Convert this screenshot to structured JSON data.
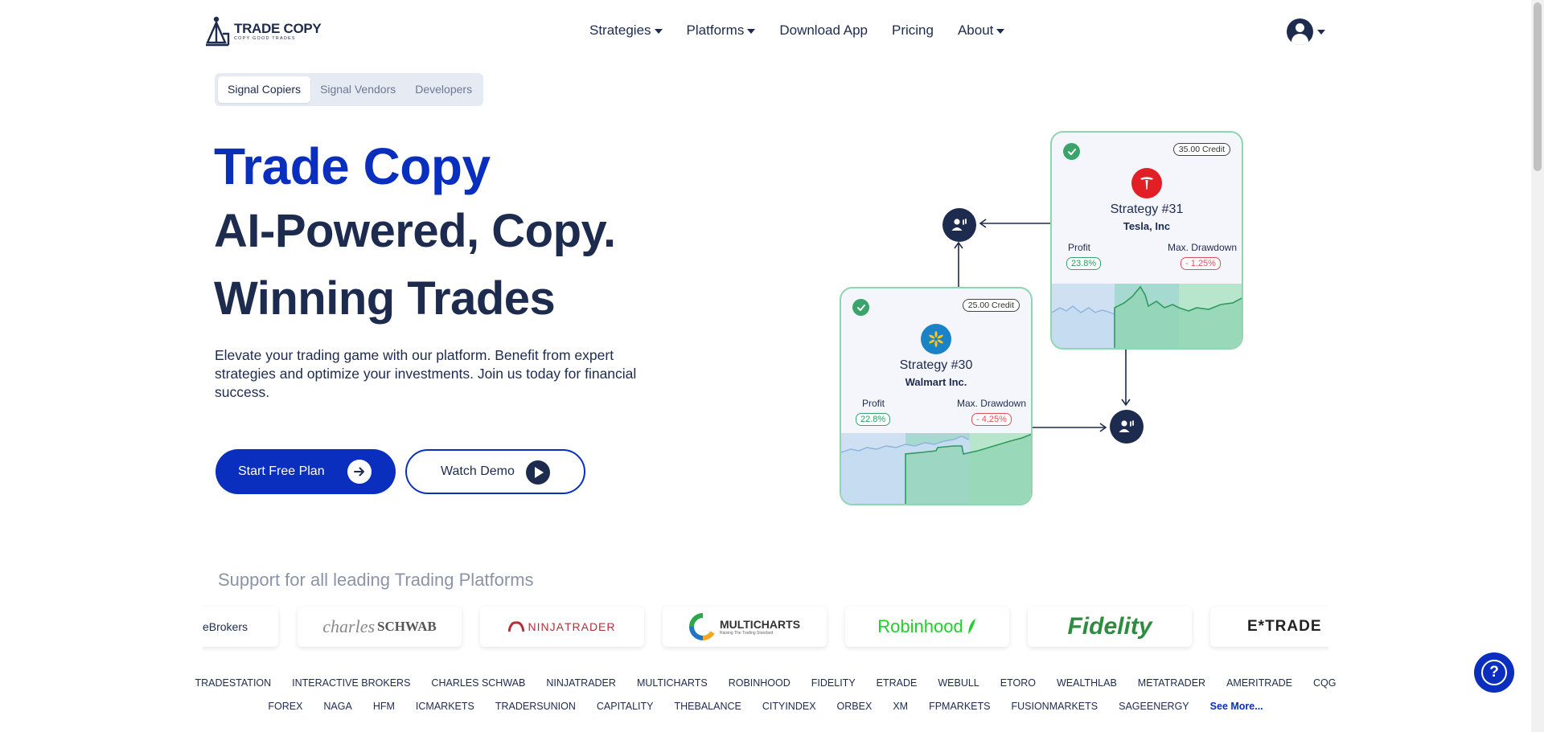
{
  "brand": {
    "name": "TRADE COPY",
    "tagline": "COPY GOOD TRADES",
    "accent": "#0a2fbf",
    "navy": "#1d2b4f"
  },
  "nav": {
    "items": [
      {
        "label": "Strategies",
        "dropdown": true
      },
      {
        "label": "Platforms",
        "dropdown": true
      },
      {
        "label": "Download App",
        "dropdown": false
      },
      {
        "label": "Pricing",
        "dropdown": false
      },
      {
        "label": "About",
        "dropdown": true
      }
    ],
    "account_icon": "user-circle-icon"
  },
  "tabs": [
    {
      "label": "Signal Copiers",
      "active": true
    },
    {
      "label": "Signal Vendors",
      "active": false
    },
    {
      "label": "Developers",
      "active": false
    }
  ],
  "hero": {
    "title_line1": "Trade Copy",
    "title_line2": "AI-Powered, Copy.",
    "title_line3": "Winning Trades",
    "description": "Elevate your trading game with our platform. Benefit from expert strategies and optimize your investments. Join us today for financial success.",
    "primary_button": "Start Free Plan",
    "secondary_button": "Watch Demo"
  },
  "strategies": [
    {
      "name": "Strategy #31",
      "company": "Tesla, Inc",
      "credit": "35.00 Credit",
      "profit_label": "Profit",
      "profit": "23.8%",
      "drawdown_label": "Max. Drawdown",
      "drawdown": "- 1.25%",
      "brand_color": "#e31f26",
      "brand_icon": "tesla-logo-icon"
    },
    {
      "name": "Strategy #30",
      "company": "Walmart Inc.",
      "credit": "25.00 Credit",
      "profit_label": "Profit",
      "profit": "22.8%",
      "drawdown_label": "Max. Drawdown",
      "drawdown": "- 4.25%",
      "brand_color": "#1a82c6",
      "brand_icon": "walmart-spark-icon"
    }
  ],
  "platforms": {
    "heading": "Support for all leading Trading Platforms",
    "logos": [
      "Interactive Brokers",
      "charles SCHWAB",
      "NINJATRADER",
      "MULTICHARTS",
      "Robinhood",
      "Fidelity",
      "E*TRADE"
    ],
    "logo_visible_text": {
      "ib": "eBrokers",
      "schwab_1": "charles",
      "schwab_2": "SCHWAB",
      "ninja_1": "NINJA",
      "ninja_2": "TRADER",
      "mc": "MULTICHARTS",
      "mc_tag": "Raising The Trading Standard",
      "robinhood": "Robinhood",
      "fidelity": "Fidelity",
      "etrade": "E*TRADE"
    },
    "row1": [
      "TRADESTATION",
      "INTERACTIVE BROKERS",
      "CHARLES SCHWAB",
      "NINJATRADER",
      "MULTICHARTS",
      "ROBINHOOD",
      "FIDELITY",
      "ETRADE",
      "WEBULL",
      "ETORO",
      "WEALTHLAB",
      "METATRADER",
      "AMERITRADE",
      "CQG"
    ],
    "row2": [
      "FOREX",
      "NAGA",
      "HFM",
      "ICMARKETS",
      "TRADERSUNION",
      "CAPITALITY",
      "THEBALANCE",
      "CITYINDEX",
      "ORBEX",
      "XM",
      "FPMARKETS",
      "FUSIONMARKETS",
      "SAGEENERGY"
    ],
    "see_more": "See More..."
  },
  "help_button": "?"
}
